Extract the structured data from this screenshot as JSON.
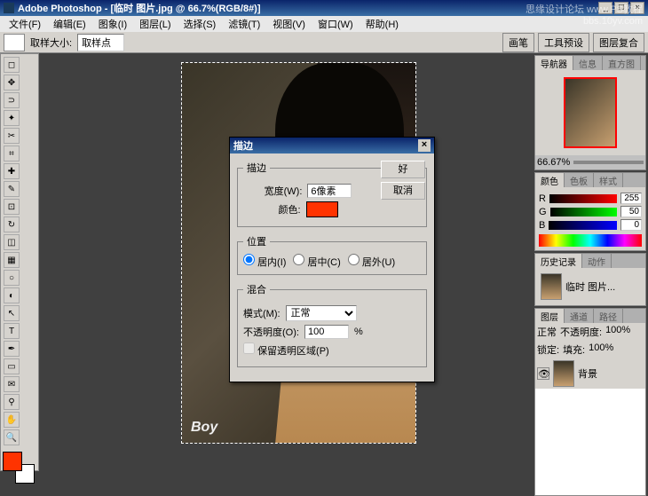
{
  "title": "Adobe Photoshop - [临时 图片.jpg @ 66.7%(RGB/8#)]",
  "menu": [
    "文件(F)",
    "编辑(E)",
    "图象(I)",
    "图层(L)",
    "选择(S)",
    "滤镜(T)",
    "视图(V)",
    "窗口(W)",
    "帮助(H)"
  ],
  "optionbar": {
    "label1": "取样大小:",
    "select1": "取样点",
    "tabs": [
      "画笔",
      "工具预设",
      "图层复合"
    ]
  },
  "navigator": {
    "tabs": [
      "导航器",
      "信息",
      "直方图"
    ],
    "zoom": "66.67%"
  },
  "color": {
    "tabs": [
      "颜色",
      "色板",
      "样式"
    ],
    "r_label": "R",
    "r_val": "255",
    "g_label": "G",
    "g_val": "50",
    "b_label": "B",
    "b_val": "0"
  },
  "history": {
    "tabs": [
      "历史记录",
      "动作"
    ],
    "item": "临时 图片..."
  },
  "layers": {
    "tabs": [
      "图层",
      "通道",
      "路径"
    ],
    "blend": "正常",
    "opacity_label": "不透明度:",
    "opacity": "100%",
    "lock_label": "锁定:",
    "fill_label": "填充:",
    "fill": "100%",
    "layer_name": "背景"
  },
  "dialog": {
    "title": "描边",
    "group1": "描边",
    "width_label": "宽度(W):",
    "width_val": "6像素",
    "color_label": "颜色:",
    "group2": "位置",
    "radio1": "居内(I)",
    "radio2": "居中(C)",
    "radio3": "居外(U)",
    "group3": "混合",
    "mode_label": "模式(M):",
    "mode_val": "正常",
    "opacity_label": "不透明度(O):",
    "opacity_val": "100",
    "opacity_pct": "%",
    "checkbox": "保留透明区域(P)",
    "ok": "好",
    "cancel": "取消"
  },
  "canvas": {
    "boy": "Boy"
  },
  "watermark": {
    "l1": "思缘设计论坛  www.PS教程",
    "l2": "bbs.10yv.com"
  }
}
